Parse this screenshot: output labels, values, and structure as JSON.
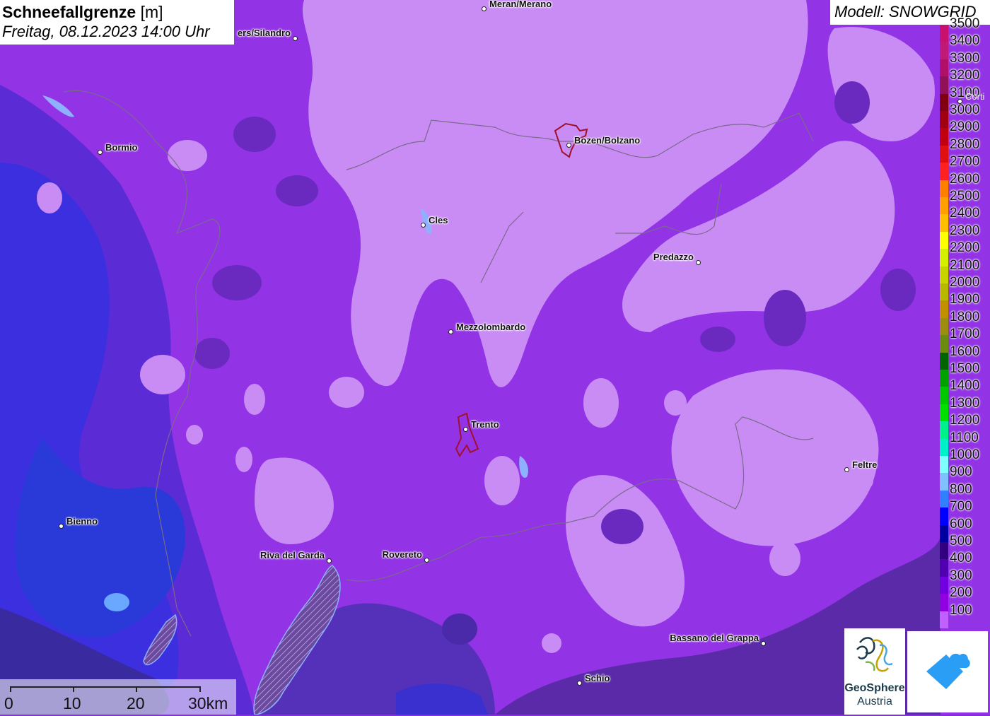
{
  "title": {
    "main": "Schneefallgrenze",
    "unit": "[m]",
    "subtitle": "Freitag, 08.12.2023 14:00 Uhr"
  },
  "model": {
    "label": "Modell: SNOWGRID"
  },
  "legend": {
    "items": [
      {
        "value": "3500",
        "color": "#c8106e"
      },
      {
        "value": "3400",
        "color": "#c01a78"
      },
      {
        "value": "3300",
        "color": "#b0106a"
      },
      {
        "value": "3200",
        "color": "#90105a"
      },
      {
        "value": "3100",
        "color": "#800010"
      },
      {
        "value": "3000",
        "color": "#a00010"
      },
      {
        "value": "2900",
        "color": "#c00010"
      },
      {
        "value": "2800",
        "color": "#e01010"
      },
      {
        "value": "2700",
        "color": "#ff2020"
      },
      {
        "value": "2600",
        "color": "#ff7f00"
      },
      {
        "value": "2500",
        "color": "#ff9f00"
      },
      {
        "value": "2400",
        "color": "#ffbf00"
      },
      {
        "value": "2300",
        "color": "#ffff00"
      },
      {
        "value": "2200",
        "color": "#d4f000"
      },
      {
        "value": "2100",
        "color": "#c8d400"
      },
      {
        "value": "2000",
        "color": "#b8b800"
      },
      {
        "value": "1900",
        "color": "#c09000"
      },
      {
        "value": "1800",
        "color": "#9c8c10"
      },
      {
        "value": "1700",
        "color": "#6a8a10"
      },
      {
        "value": "1600",
        "color": "#006400"
      },
      {
        "value": "1500",
        "color": "#00a000"
      },
      {
        "value": "1400",
        "color": "#00c800"
      },
      {
        "value": "1300",
        "color": "#00e000"
      },
      {
        "value": "1200",
        "color": "#00f08c"
      },
      {
        "value": "1100",
        "color": "#00f0c8"
      },
      {
        "value": "1000",
        "color": "#80ffff"
      },
      {
        "value": "900",
        "color": "#80c0ff"
      },
      {
        "value": "800",
        "color": "#3080ff"
      },
      {
        "value": "700",
        "color": "#0000ff"
      },
      {
        "value": "600",
        "color": "#0000a0"
      },
      {
        "value": "500",
        "color": "#300080"
      },
      {
        "value": "400",
        "color": "#5000b0"
      },
      {
        "value": "300",
        "color": "#7000e0"
      },
      {
        "value": "200",
        "color": "#9000e0"
      },
      {
        "value": "100",
        "color": "#c060ff"
      }
    ]
  },
  "cities": [
    {
      "name": "Meran/Merano"
    },
    {
      "name": "ers/Silandro"
    },
    {
      "name": "Bozen/Bolzano"
    },
    {
      "name": "Bormio"
    },
    {
      "name": "Cles"
    },
    {
      "name": "Predazzo"
    },
    {
      "name": "Mezzolombardo"
    },
    {
      "name": "Trento"
    },
    {
      "name": "Feltre"
    },
    {
      "name": "Bienno"
    },
    {
      "name": "Riva del Garda"
    },
    {
      "name": "Rovereto"
    },
    {
      "name": "Bassano del Grappa"
    },
    {
      "name": "Schio"
    },
    {
      "name": "Corti"
    }
  ],
  "scale": {
    "labels": [
      "0",
      "10",
      "20",
      "30km"
    ]
  },
  "logos": {
    "geosphere_line1": "GeoSphere",
    "geosphere_line2": "Austria"
  }
}
